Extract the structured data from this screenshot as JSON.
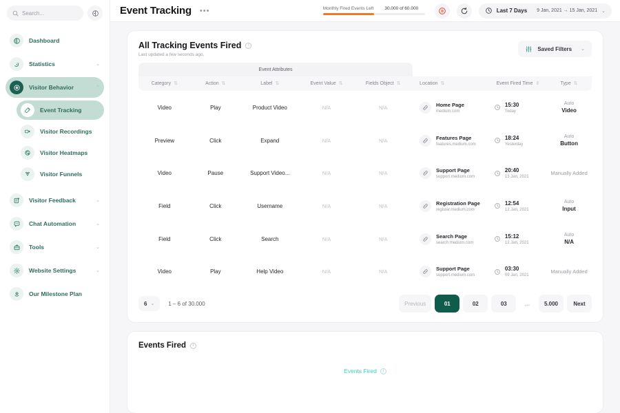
{
  "sidebar": {
    "search": {
      "placeholder": "Search...",
      "icon": "search-icon"
    },
    "collapse_icon": "collapse-panel-icon",
    "items": [
      {
        "label": "Dashboard",
        "icon": "dashboard-icon",
        "expandable": false,
        "active": false
      },
      {
        "label": "Statistics",
        "icon": "statistics-icon",
        "expandable": true,
        "active": false
      },
      {
        "label": "Visitor Behavior",
        "icon": "visitor-behavior-icon",
        "expandable": true,
        "active": true,
        "expanded": true
      },
      {
        "label": "Visitor Feedback",
        "icon": "visitor-feedback-icon",
        "expandable": true,
        "active": false
      },
      {
        "label": "Chat Automation",
        "icon": "chat-automation-icon",
        "expandable": true,
        "active": false
      },
      {
        "label": "Tools",
        "icon": "tools-icon",
        "expandable": true,
        "active": false
      },
      {
        "label": "Website Settings",
        "icon": "settings-gear-icon",
        "expandable": true,
        "active": false
      },
      {
        "label": "Our Milestone Plan",
        "icon": "milestone-icon",
        "expandable": false,
        "active": false
      }
    ],
    "sub_items": [
      {
        "label": "Event Tracking",
        "icon": "tag-icon",
        "active": true
      },
      {
        "label": "Visitor Recordings",
        "icon": "video-camera-icon",
        "active": false
      },
      {
        "label": "Visitor Heatmaps",
        "icon": "heatmap-icon",
        "active": false
      },
      {
        "label": "Visitor Funnels",
        "icon": "funnel-icon",
        "active": false
      }
    ]
  },
  "header": {
    "title": "Event Tracking",
    "more_label": "•••",
    "quota": {
      "label": "Monthly Fired Events Left",
      "value": "30.000 of 60.000",
      "percent": 50,
      "bar_color": "#f5751f"
    },
    "pause_icon": "pause-circle-icon",
    "refresh_icon": "refresh-icon",
    "date": {
      "clock_icon": "clock-icon",
      "preset": "Last 7 Days",
      "range": "9 Jan, 2021 → 15 Jan, 2021",
      "chevron": "chevron-down-icon"
    }
  },
  "table_card": {
    "title": "All Tracking Events Fired",
    "info_icon": "info-icon",
    "subtitle": "Last updated a few seconds ago.",
    "saved_filters": {
      "label": "Saved Filters",
      "icon": "filter-sliders-icon",
      "chevron": "chevron-down-icon"
    },
    "group_header": "Event Attributes",
    "columns": [
      {
        "label": "Category",
        "sort": "sort-icon"
      },
      {
        "label": "Action",
        "sort": "sort-icon"
      },
      {
        "label": "Label",
        "sort": "sort-icon"
      },
      {
        "label": "Event Value",
        "sort": "sort-icon"
      },
      {
        "label": "Fields Object",
        "sort": "sort-icon"
      },
      {
        "label": "Location",
        "sort": "sort-icon"
      },
      {
        "label": "Event Fired Time",
        "sort": "sort-updown-icon"
      },
      {
        "label": "Type",
        "sort": "sort-icon"
      }
    ],
    "rows": [
      {
        "category": "Video",
        "action": "Play",
        "label": "Product Video",
        "event_value": "N/A",
        "fields_object": "N/A",
        "location_name": "Home Page",
        "location_url": "medium.com",
        "time": "15:30",
        "date": "Today",
        "type_top": "Auto",
        "type_bottom": "Video"
      },
      {
        "category": "Preview",
        "action": "Click",
        "label": "Expand",
        "event_value": "N/A",
        "fields_object": "N/A",
        "location_name": "Features Page",
        "location_url": "features.medium.com",
        "time": "18:24",
        "date": "Yesterday",
        "type_top": "Auto",
        "type_bottom": "Button"
      },
      {
        "category": "Video",
        "action": "Pause",
        "label": "Support Video...",
        "event_value": "N/A",
        "fields_object": "N/A",
        "location_name": "Support Page",
        "location_url": "support.medium.com",
        "time": "20:40",
        "date": "13 Jan, 2021",
        "type_top": "",
        "type_bottom": "",
        "type_single": "Manually Added"
      },
      {
        "category": "Field",
        "action": "Click",
        "label": "Username",
        "event_value": "N/A",
        "fields_object": "N/A",
        "location_name": "Registration Page",
        "location_url": "register.medium.com",
        "time": "12:54",
        "date": "12 Jan, 2021",
        "type_top": "Auto",
        "type_bottom": "Input"
      },
      {
        "category": "Field",
        "action": "Click",
        "label": "Search",
        "event_value": "N/A",
        "fields_object": "N/A",
        "location_name": "Search Page",
        "location_url": "search.medium.com",
        "time": "15:12",
        "date": "12 Jan, 2021",
        "type_top": "Auto",
        "type_bottom": "N/A"
      },
      {
        "category": "Video",
        "action": "Play",
        "label": "Help Video",
        "event_value": "N/A",
        "fields_object": "N/A",
        "location_name": "Support Page",
        "location_url": "support.medium.com",
        "time": "03:30",
        "date": "09 Jan, 2021",
        "type_top": "",
        "type_bottom": "",
        "type_single": "Manually Added"
      }
    ],
    "pagination": {
      "per_page": "6",
      "per_page_chevron": "chevron-down-icon",
      "range_text": "1 – 6 of 30.000",
      "previous": "Previous",
      "pages": [
        "01",
        "02",
        "03",
        "...",
        "5.000"
      ],
      "active_page": "01",
      "next": "Next"
    }
  },
  "events_fired_card": {
    "title": "Events Fired",
    "info_icon": "info-icon",
    "legend_label": "Events Fired",
    "legend_info_icon": "info-icon",
    "legend_color": "#3ecfc0"
  }
}
